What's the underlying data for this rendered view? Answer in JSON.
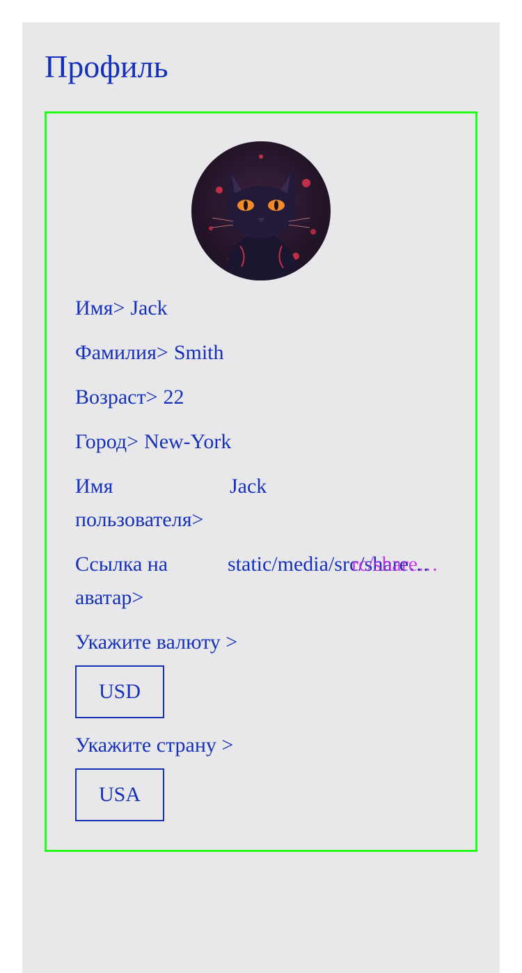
{
  "page": {
    "title": "Профиль"
  },
  "profile": {
    "avatar_icon": "cat-avatar-icon",
    "fields": {
      "first_name_label": "Имя>",
      "first_name_value": "Jack",
      "last_name_label": "Фамилия>",
      "last_name_value": "Smith",
      "age_label": "Возраст>",
      "age_value": "22",
      "city_label": "Город>",
      "city_value": "New-York",
      "username_label": "Имя пользователя>",
      "username_value": "Jack",
      "avatar_link_label": "Ссылка на аватар>",
      "avatar_link_value": "static/media/src/share…",
      "avatar_link_overlap": "rc/share…"
    },
    "currency": {
      "label": "Укажите валюту >",
      "selected": "USD"
    },
    "country": {
      "label": "Укажите страну >",
      "selected": "USA"
    }
  },
  "colors": {
    "text": "#1531b8",
    "card_border": "#22ff1a",
    "panel_background": "#e8e7ea"
  }
}
